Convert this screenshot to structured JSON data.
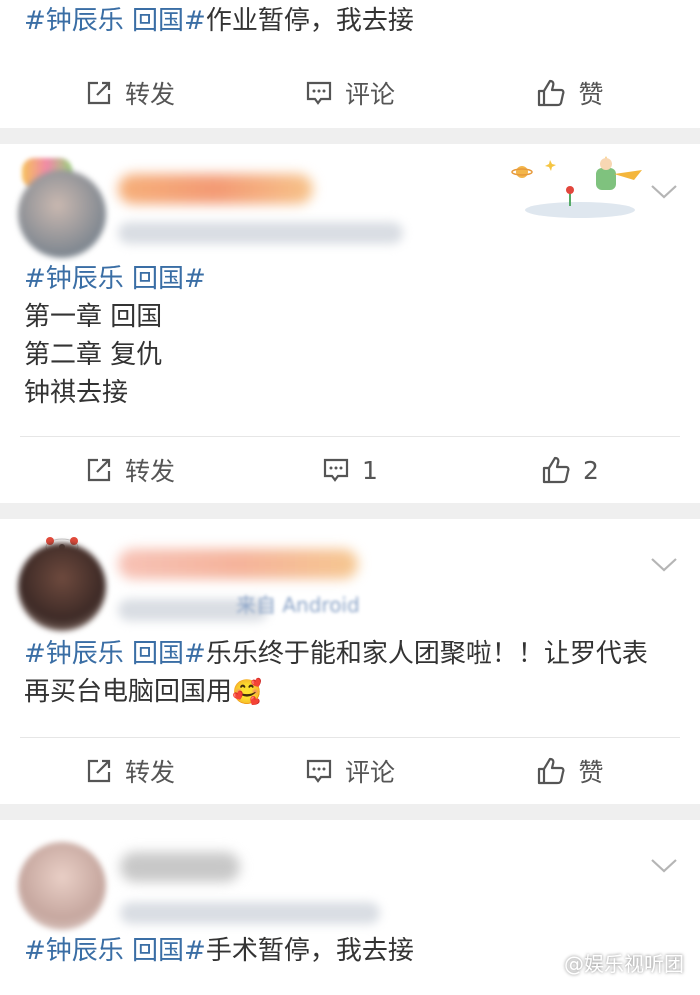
{
  "post1": {
    "text_tag": "#钟辰乐 回国#",
    "text_rest": "作业暂停，我去接",
    "actions": {
      "repost": "转发",
      "comment": "评论",
      "like": "赞"
    }
  },
  "post2": {
    "tag": "#钟辰乐 回国#",
    "lines": [
      "第一章 回国",
      "第二章 复仇",
      "钟祺去接"
    ],
    "actions": {
      "repost": "转发",
      "comment": "1",
      "like": "2"
    }
  },
  "post3": {
    "meta_visible": "来自 Android",
    "text_tag": "#钟辰乐 回国#",
    "text_rest": "乐乐终于能和家人团聚啦！！让罗代表再买台电脑回国用",
    "emoji": "🥰",
    "actions": {
      "repost": "转发",
      "comment": "评论",
      "like": "赞"
    }
  },
  "post4": {
    "text_tag": "#钟辰乐 回国#",
    "text_rest": "手术暂停，我去接"
  },
  "watermark": "@娱乐视听团",
  "colors": {
    "tag": "#3a6ea5",
    "separator": "#efefef",
    "text": "#333333"
  }
}
